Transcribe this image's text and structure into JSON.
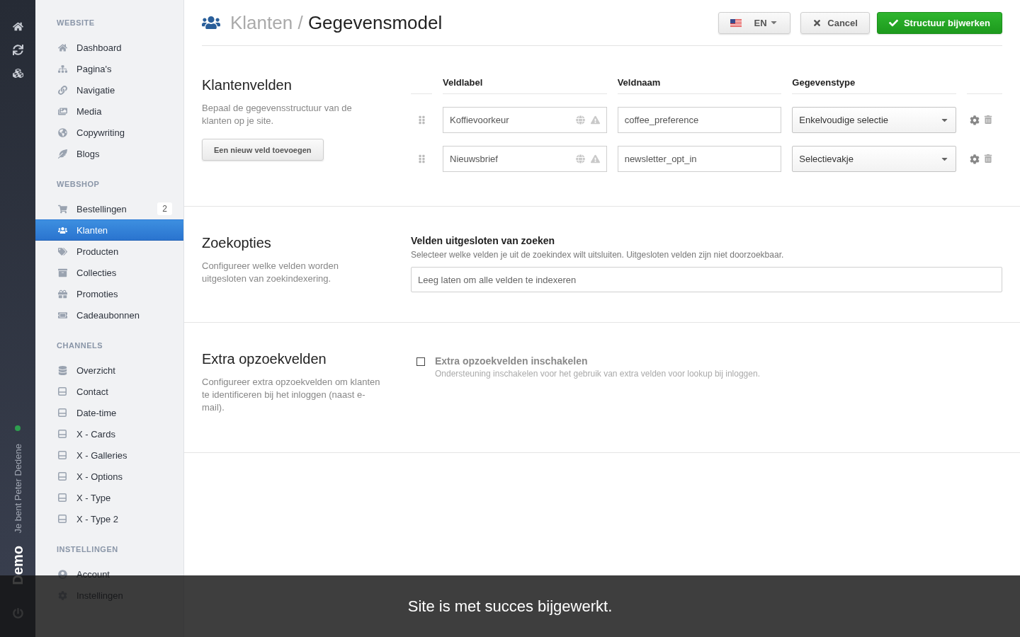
{
  "rail": {
    "user": "Je bent Peter Dedene",
    "online": true,
    "brand": "Demo"
  },
  "sidebar": {
    "sections": [
      {
        "title": "WEBSITE",
        "items": [
          {
            "label": "Dashboard",
            "selected": false
          },
          {
            "label": "Pagina's",
            "selected": false
          },
          {
            "label": "Navigatie",
            "selected": false
          },
          {
            "label": "Media",
            "selected": false
          },
          {
            "label": "Copywriting",
            "selected": false
          },
          {
            "label": "Blogs",
            "selected": false
          }
        ]
      },
      {
        "title": "WEBSHOP",
        "items": [
          {
            "label": "Bestellingen",
            "selected": false,
            "badge": "2"
          },
          {
            "label": "Klanten",
            "selected": true
          },
          {
            "label": "Producten",
            "selected": false
          },
          {
            "label": "Collecties",
            "selected": false
          },
          {
            "label": "Promoties",
            "selected": false
          },
          {
            "label": "Cadeaubonnen",
            "selected": false
          }
        ]
      },
      {
        "title": "CHANNELS",
        "items": [
          {
            "label": "Overzicht",
            "selected": false
          },
          {
            "label": "Contact",
            "selected": false
          },
          {
            "label": "Date-time",
            "selected": false
          },
          {
            "label": "X - Cards",
            "selected": false
          },
          {
            "label": "X - Galleries",
            "selected": false
          },
          {
            "label": "X - Options",
            "selected": false
          },
          {
            "label": "X - Type",
            "selected": false
          },
          {
            "label": "X - Type 2",
            "selected": false
          }
        ]
      },
      {
        "title": "INSTELLINGEN",
        "items": [
          {
            "label": "Account",
            "selected": false
          },
          {
            "label": "Instellingen",
            "selected": false
          }
        ]
      }
    ]
  },
  "header": {
    "parent": "Klanten",
    "separator": "/",
    "title": "Gegevensmodel",
    "language": "EN",
    "cancel": "Cancel",
    "save": "Structuur bijwerken"
  },
  "fields_section": {
    "title": "Klantenvelden",
    "description": "Bepaal de gegevensstructuur van de klanten op je site.",
    "add_button": "Een nieuw veld toevoegen",
    "columns": [
      "Veldlabel",
      "Veldnaam",
      "Gegevenstype"
    ],
    "rows": [
      {
        "label": "Koffievoorkeur",
        "name": "coffee_preference",
        "type": "Enkelvoudige selectie"
      },
      {
        "label": "Nieuwsbrief",
        "name": "newsletter_opt_in",
        "type": "Selectievakje"
      }
    ]
  },
  "search_section": {
    "title": "Zoekopties",
    "description": "Configureer welke velden worden uitgesloten van zoekindexering.",
    "field_title": "Velden uitgesloten van zoeken",
    "field_help": "Selecteer welke velden je uit de zoekindex wilt uitsluiten. Uitgesloten velden zijn niet doorzoekbaar.",
    "placeholder": "Leeg laten om alle velden te indexeren"
  },
  "lookup_section": {
    "title": "Extra opzoekvelden",
    "description": "Configureer extra opzoekvelden om klanten te identificeren bij het inloggen (naast e-mail).",
    "checkbox_label": "Extra opzoekvelden inschakelen",
    "checkbox_help": "Ondersteuning inschakelen voor het gebruik van extra velden voor lookup bij inloggen.",
    "checked": false
  },
  "toast": {
    "message": "Site is met succes bijgewerkt."
  }
}
